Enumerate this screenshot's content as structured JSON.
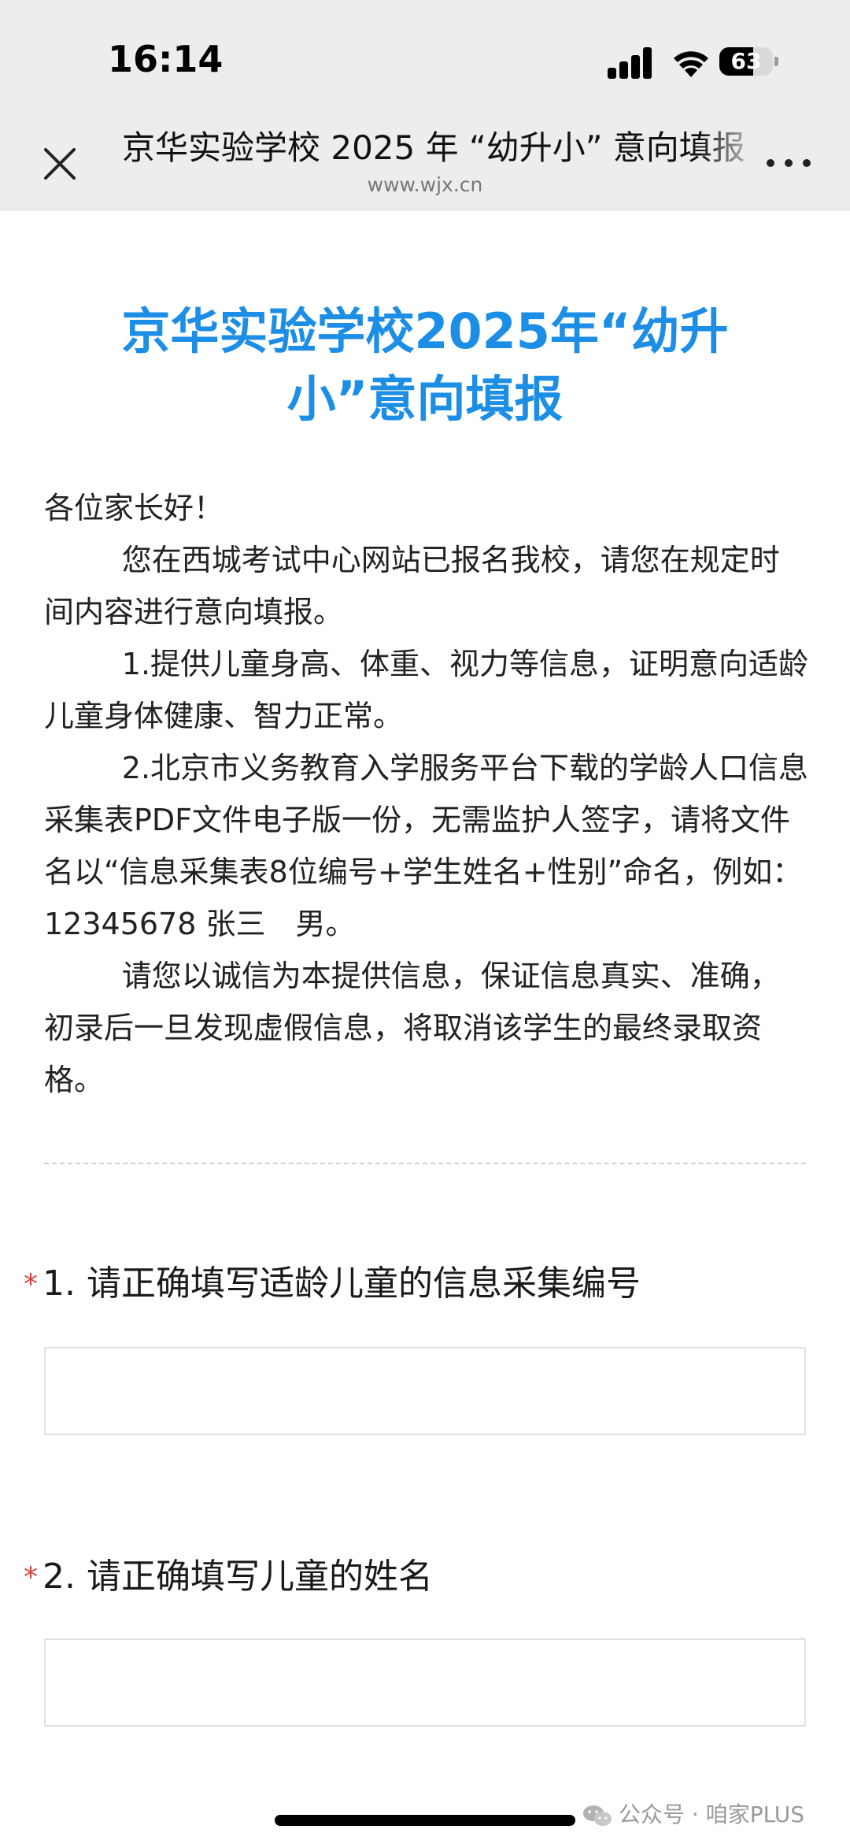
{
  "status_bar": {
    "time": "16:14",
    "battery_level": "63",
    "battery_fraction": 0.63,
    "icons": [
      "signal-icon",
      "wifi-icon",
      "battery-icon"
    ]
  },
  "nav": {
    "title": "京华实验学校 2025 年 “幼升小” 意向填报",
    "domain": "www.wjx.cn",
    "icons": [
      "close-icon",
      "more-icon"
    ]
  },
  "form": {
    "title_line1": "京华实验学校2025年“幼升",
    "title_line2": "小”意向填报",
    "title_color": "#1d8ee6",
    "intro": {
      "greeting": "各位家长好！",
      "p1": "您在西城考试中心网站已报名我校，请您在规定时间内容进行意向填报。",
      "p2": "1.提供儿童身高、体重、视力等信息，证明意向适龄儿童身体健康、智力正常。",
      "p3": "2.北京市义务教育入学服务平台下载的学龄人口信息采集表PDF文件电子版一份，无需监护人签字，请将文件名以“信息采集表8位编号+学生姓名+性别”命名，例如：12345678 张三　男。",
      "p4": "请您以诚信为本提供信息，保证信息真实、准确，初录后一旦发现虚假信息，将取消该学生的最终录取资格。"
    },
    "questions": [
      {
        "required_mark": "*",
        "label": "1. 请正确填写适龄儿童的信息采集编号",
        "value": ""
      },
      {
        "required_mark": "*",
        "label": "2. 请正确填写儿童的姓名",
        "value": ""
      }
    ],
    "required_color": "#e14040"
  },
  "watermark": {
    "text": "公众号 · 咱家PLUS",
    "icon": "wechat-icon"
  }
}
